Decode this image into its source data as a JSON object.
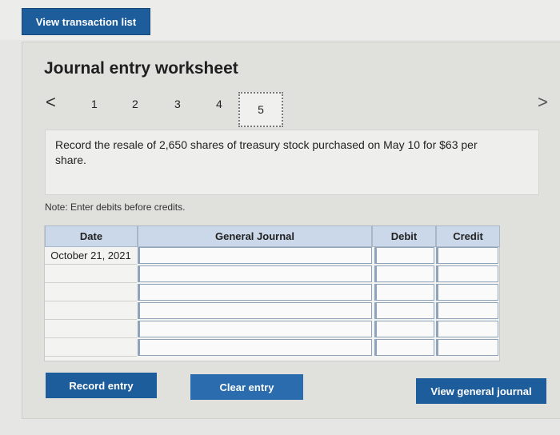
{
  "top_button": "View transaction list",
  "title": "Journal entry worksheet",
  "pager": {
    "prev": "<",
    "next": ">",
    "steps": [
      "1",
      "2",
      "3",
      "4"
    ],
    "active": "5"
  },
  "question": "Record the resale of 2,650 shares of treasury stock purchased on May 10 for $63 per share.",
  "note": "Note: Enter debits before credits.",
  "table": {
    "headers": {
      "date": "Date",
      "journal": "General Journal",
      "debit": "Debit",
      "credit": "Credit"
    },
    "first_date": "October 21, 2021"
  },
  "buttons": {
    "record": "Record entry",
    "clear": "Clear entry",
    "view_journal": "View general journal"
  }
}
